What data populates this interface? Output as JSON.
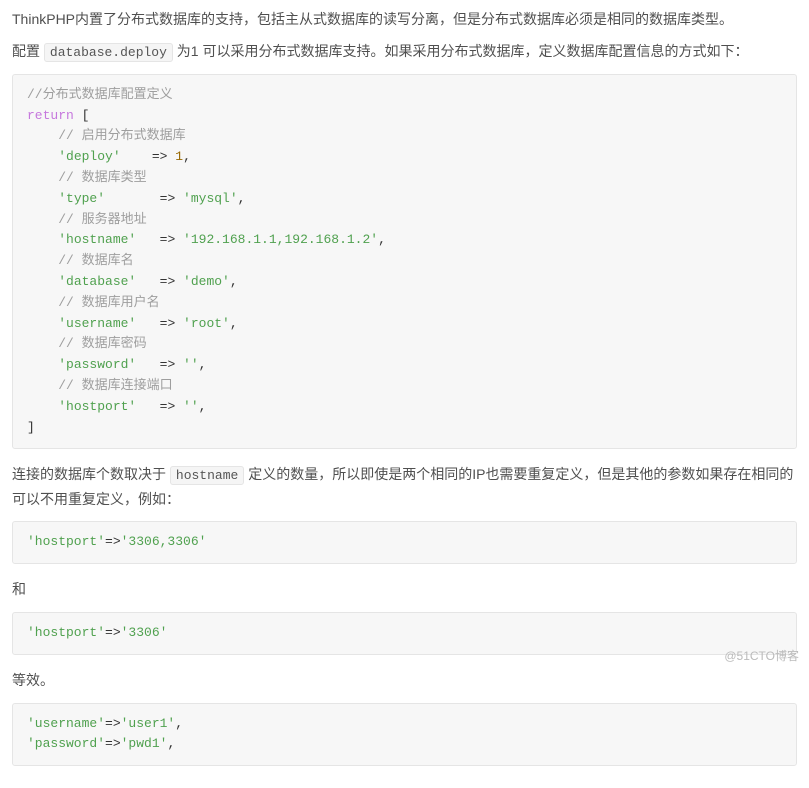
{
  "para1_a": "ThinkPHP内置了分布式数据库的支持，包括主从式数据库的读写分离，但是分布式数据库必须是相同的数据库类型。",
  "para2_a": "配置 ",
  "para2_code": "database.deploy",
  "para2_b": " 为1 可以采用分布式数据库支持。如果采用分布式数据库，定义数据库配置信息的方式如下：",
  "code1": {
    "l01": "//分布式数据库配置定义",
    "l02a": "return",
    "l02b": " [",
    "l03": "// 启用分布式数据库",
    "l04a": "'deploy'",
    "l04b": "    => ",
    "l04c": "1",
    "l04d": ",",
    "l05": "// 数据库类型",
    "l06a": "'type'",
    "l06b": "       => ",
    "l06c": "'mysql'",
    "l06d": ",",
    "l07": "// 服务器地址",
    "l08a": "'hostname'",
    "l08b": "   => ",
    "l08c": "'192.168.1.1,192.168.1.2'",
    "l08d": ",",
    "l09": "// 数据库名",
    "l10a": "'database'",
    "l10b": "   => ",
    "l10c": "'demo'",
    "l10d": ",",
    "l11": "// 数据库用户名",
    "l12a": "'username'",
    "l12b": "   => ",
    "l12c": "'root'",
    "l12d": ",",
    "l13": "// 数据库密码",
    "l14a": "'password'",
    "l14b": "   => ",
    "l14c": "''",
    "l14d": ",",
    "l15": "// 数据库连接端口",
    "l16a": "'hostport'",
    "l16b": "   => ",
    "l16c": "''",
    "l16d": ",",
    "l17": "]"
  },
  "para3_a": "连接的数据库个数取决于 ",
  "para3_code": "hostname",
  "para3_b": " 定义的数量，所以即使是两个相同的IP也需要重复定义，但是其他的参数如果存在相同的可以不用重复定义，例如：",
  "code2_a": "'hostport'",
  "code2_b": "=>",
  "code2_c": "'3306,3306'",
  "para4": "和",
  "code3_a": "'hostport'",
  "code3_b": "=>",
  "code3_c": "'3306'",
  "para5": "等效。",
  "code4_1a": "'username'",
  "code4_1b": "=>",
  "code4_1c": "'user1'",
  "code4_1d": ",",
  "code4_2a": "'password'",
  "code4_2b": "=>",
  "code4_2c": "'pwd1'",
  "code4_2d": ",",
  "watermark": "@51CTO博客"
}
